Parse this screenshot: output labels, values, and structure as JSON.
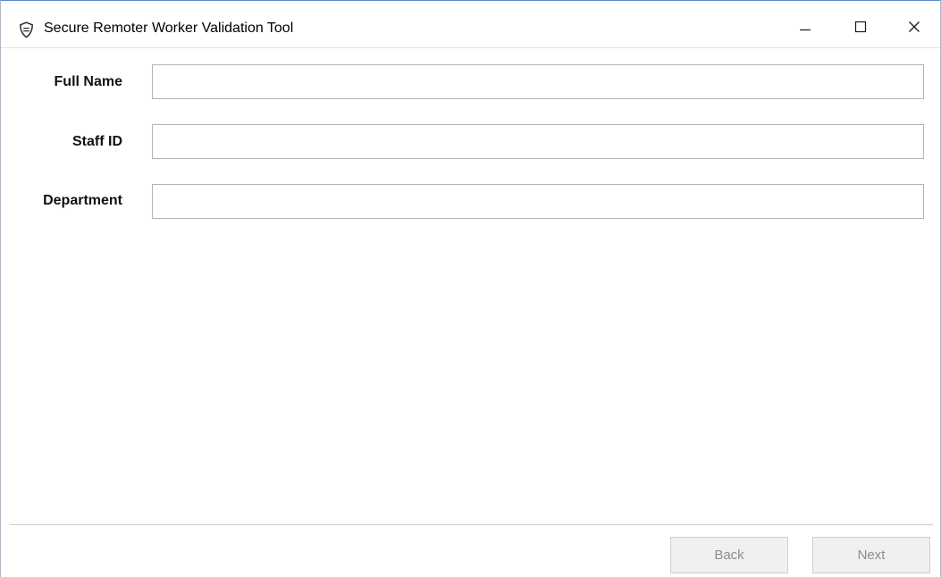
{
  "window": {
    "title": "Secure Remoter Worker Validation Tool",
    "icon": "shield-icon",
    "controls": {
      "minimize": "minimize-icon",
      "maximize": "maximize-icon",
      "close": "close-icon"
    },
    "accent_color": "#5a86c8"
  },
  "form": {
    "fields": [
      {
        "label": "Full Name",
        "value": "",
        "placeholder": ""
      },
      {
        "label": "Staff ID",
        "value": "",
        "placeholder": ""
      },
      {
        "label": "Department",
        "value": "",
        "placeholder": ""
      }
    ]
  },
  "footer": {
    "back_label": "Back",
    "next_label": "Next",
    "back_enabled": false,
    "next_enabled": false
  }
}
